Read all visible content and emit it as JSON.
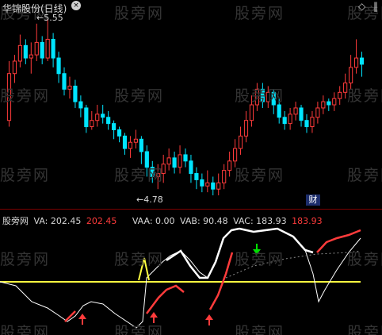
{
  "header": {
    "title": "华锦股份(日线)",
    "close_symbol": "×",
    "right_icons": "◇ ‖"
  },
  "price_chart": {
    "high_label": "5.55",
    "low_label": "4.78",
    "badge": "财",
    "up_color": "#ff3b3b",
    "down_color": "#00e5ff",
    "candles": [
      [
        4.9,
        5.2,
        5.28,
        4.86
      ],
      [
        5.2,
        5.28,
        5.32,
        5.14
      ],
      [
        5.28,
        5.38,
        5.45,
        5.24
      ],
      [
        5.38,
        5.3,
        5.42,
        5.26
      ],
      [
        5.3,
        5.32,
        5.4,
        5.2
      ],
      [
        5.32,
        5.4,
        5.52,
        5.28
      ],
      [
        5.4,
        5.3,
        5.44,
        5.26
      ],
      [
        5.3,
        5.42,
        5.55,
        5.28
      ],
      [
        5.42,
        5.3,
        5.46,
        5.24
      ],
      [
        5.3,
        5.2,
        5.34,
        5.14
      ],
      [
        5.2,
        5.1,
        5.24,
        5.06
      ],
      [
        5.1,
        5.12,
        5.18,
        5.04
      ],
      [
        5.12,
        5.02,
        5.16,
        4.98
      ],
      [
        5.02,
        4.98,
        5.06,
        4.92
      ],
      [
        4.98,
        4.86,
        5.0,
        4.82
      ],
      [
        4.86,
        4.9,
        4.96,
        4.84
      ],
      [
        4.9,
        4.94,
        5.0,
        4.86
      ],
      [
        4.94,
        4.92,
        5.0,
        4.88
      ],
      [
        4.92,
        4.88,
        4.96,
        4.84
      ],
      [
        4.88,
        4.84,
        4.9,
        4.78
      ],
      [
        4.84,
        4.8,
        4.86,
        4.76
      ],
      [
        4.8,
        4.72,
        4.82,
        4.68
      ],
      [
        4.72,
        4.76,
        4.8,
        4.66
      ],
      [
        4.76,
        4.78,
        4.84,
        4.72
      ],
      [
        4.78,
        4.7,
        4.8,
        4.62
      ],
      [
        4.7,
        4.6,
        4.74,
        4.54
      ],
      [
        4.6,
        4.54,
        4.64,
        4.5
      ],
      [
        4.54,
        4.56,
        4.62,
        4.46
      ],
      [
        4.56,
        4.62,
        4.68,
        4.5
      ],
      [
        4.62,
        4.66,
        4.72,
        4.58
      ],
      [
        4.66,
        4.6,
        4.7,
        4.56
      ],
      [
        4.6,
        4.68,
        4.74,
        4.56
      ],
      [
        4.68,
        4.64,
        4.72,
        4.6
      ],
      [
        4.64,
        4.56,
        4.68,
        4.5
      ],
      [
        4.56,
        4.52,
        4.6,
        4.46
      ],
      [
        4.52,
        4.48,
        4.56,
        4.44
      ],
      [
        4.48,
        4.5,
        4.58,
        4.44
      ],
      [
        4.5,
        4.46,
        4.54,
        4.42
      ],
      [
        4.46,
        4.5,
        4.56,
        4.42
      ],
      [
        4.5,
        4.58,
        4.62,
        4.46
      ],
      [
        4.58,
        4.64,
        4.7,
        4.54
      ],
      [
        4.64,
        4.72,
        4.78,
        4.6
      ],
      [
        4.72,
        4.8,
        4.86,
        4.68
      ],
      [
        4.8,
        4.9,
        4.96,
        4.76
      ],
      [
        4.9,
        5.0,
        5.06,
        4.86
      ],
      [
        5.0,
        5.1,
        5.14,
        4.96
      ],
      [
        5.1,
        5.02,
        5.14,
        4.98
      ],
      [
        5.02,
        5.08,
        5.12,
        4.98
      ],
      [
        5.08,
        5.0,
        5.1,
        4.94
      ],
      [
        5.0,
        4.92,
        5.04,
        4.88
      ],
      [
        4.92,
        4.88,
        4.96,
        4.84
      ],
      [
        4.88,
        4.94,
        4.98,
        4.84
      ],
      [
        4.94,
        4.98,
        5.02,
        4.9
      ],
      [
        4.98,
        4.9,
        5.0,
        4.86
      ],
      [
        4.9,
        4.86,
        4.94,
        4.82
      ],
      [
        4.86,
        4.92,
        4.96,
        4.82
      ],
      [
        4.92,
        4.98,
        5.02,
        4.88
      ],
      [
        4.98,
        5.02,
        5.06,
        4.94
      ],
      [
        5.02,
        5.0,
        5.04,
        4.96
      ],
      [
        5.0,
        5.04,
        5.08,
        4.96
      ],
      [
        5.04,
        5.08,
        5.12,
        5.0
      ],
      [
        5.08,
        5.14,
        5.2,
        5.04
      ],
      [
        5.14,
        5.24,
        5.32,
        5.1
      ],
      [
        5.24,
        5.3,
        5.42,
        5.2
      ],
      [
        5.3,
        5.26,
        5.34,
        5.18
      ]
    ]
  },
  "indicator": {
    "name": "股旁网",
    "va_label": "VA: 202.45",
    "va_value": "202.45",
    "vaa_label": "VAA: 0.00",
    "vab_label": "VAB: 90.48",
    "vac_label": "VAC: 183.93",
    "vac_value": "183.93",
    "colors": {
      "text": "#d8d8d8",
      "red": "#ff3b3b",
      "yellow": "#ffff40",
      "white": "#ffffff",
      "green": "#00e000"
    }
  },
  "watermark": "股旁网"
}
